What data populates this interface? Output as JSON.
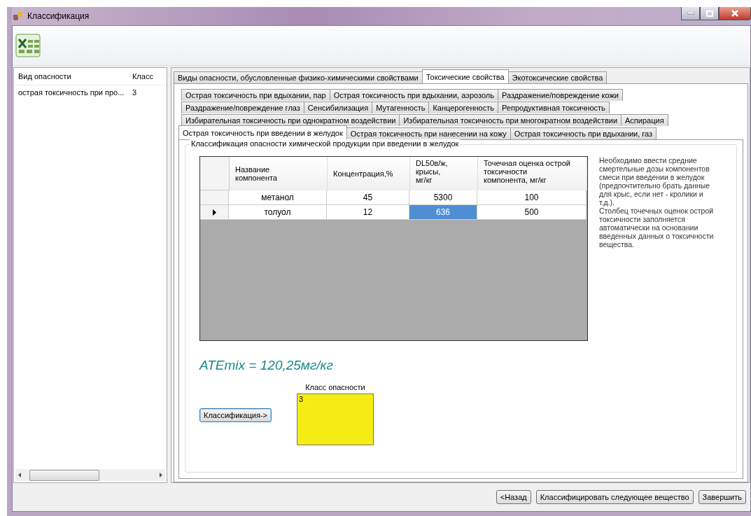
{
  "window": {
    "title": "Классификация"
  },
  "hazard_list": {
    "columns": [
      "Вид опасности",
      "Класс"
    ],
    "rows": [
      {
        "cells": [
          "острая токсичность при про...",
          "3"
        ]
      }
    ]
  },
  "main_tabs": [
    {
      "label": "Виды опасности, обусловленные физико-химическими свойствами",
      "selected": false
    },
    {
      "label": "Токсические свойства",
      "selected": true
    },
    {
      "label": "Экотоксические свойства",
      "selected": false
    }
  ],
  "sub_tab_rows": [
    [
      {
        "label": "Острая токсичность при вдыхании, пар",
        "selected": false
      },
      {
        "label": "Острая токсичность при вдыхании, аэрозоль",
        "selected": false
      },
      {
        "label": "Раздражение/повреждение кожи",
        "selected": false
      }
    ],
    [
      {
        "label": "Раздражение/повреждение глаз",
        "selected": false
      },
      {
        "label": "Сенсибилизация",
        "selected": false
      },
      {
        "label": "Мутагенность",
        "selected": false
      },
      {
        "label": "Канцерогенность",
        "selected": false
      },
      {
        "label": "Репродуктивная токсичность",
        "selected": false
      }
    ],
    [
      {
        "label": "Избирательная токсичность при однократном воздействии",
        "selected": false
      },
      {
        "label": "Избирательная токсичность при многократном воздействии",
        "selected": false
      },
      {
        "label": "Аспирация",
        "selected": false
      }
    ],
    [
      {
        "label": "Острая токсичность при введении в желудок",
        "selected": true
      },
      {
        "label": "Острая токсичность при нанесении на кожу",
        "selected": false
      },
      {
        "label": "Острая токсичность при вдыхании, газ",
        "selected": false
      }
    ]
  ],
  "group": {
    "title": "Классификация опасности химической продукции при введении в желудок",
    "table": {
      "columns": [
        "Название компонента",
        "Концентрация,%",
        "DL50в/ж, крысы, мг/кг",
        "Точечная оценка острой токсичности компонента, мг/кг"
      ],
      "rows": [
        {
          "current": false,
          "cells": [
            {
              "text": "метанол",
              "selected": false
            },
            {
              "text": "45",
              "selected": false
            },
            {
              "text": "5300",
              "selected": false
            },
            {
              "text": "100",
              "selected": false
            }
          ]
        },
        {
          "current": true,
          "cells": [
            {
              "text": "толуол",
              "selected": false
            },
            {
              "text": "12",
              "selected": false
            },
            {
              "text": "636",
              "selected": true
            },
            {
              "text": "500",
              "selected": false
            }
          ]
        }
      ]
    },
    "hint": [
      "Необходимо ввести средние смертельные дозы компонентов смеси при введении в желудок (предпочтительно брать данные для крыс, если нет - кролики и т.д.).",
      "Столбец точечных оценок острой токсичности заполняется автоматически на основании введенных данных о токсичности вещества."
    ],
    "result": "ATEmix = 120,25мг/кг",
    "classify_button": "Классификация->",
    "class_label": "Класс опасности",
    "class_value": "3"
  },
  "footer_buttons": [
    "<Назад",
    "Классифицировать следующее вещество",
    "Завершить"
  ]
}
